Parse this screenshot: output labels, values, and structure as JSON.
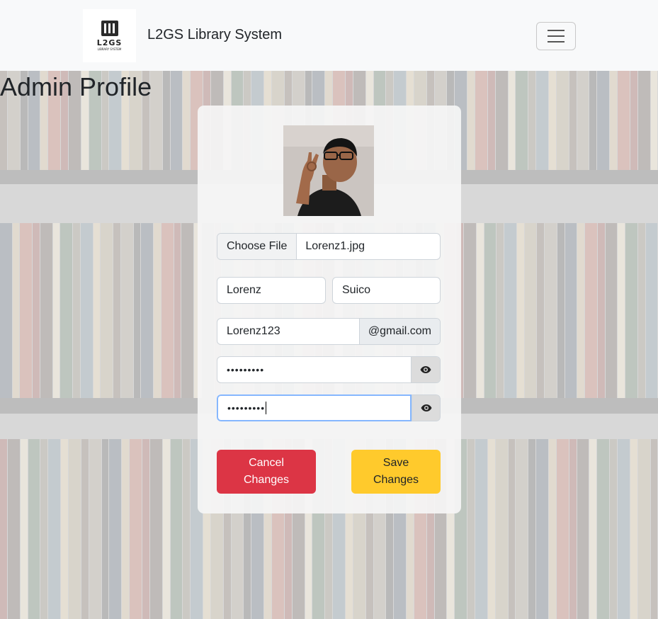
{
  "navbar": {
    "logo_text": "L2GS",
    "logo_subtext": "LIBRARY SYSTEM",
    "brand": "L2GS Library System"
  },
  "page": {
    "title": "Admin Profile"
  },
  "form": {
    "file_button": "Choose File",
    "file_name": "Lorenz1.jpg",
    "first_name": "Lorenz",
    "last_name": "Suico",
    "email_user": "Lorenz123",
    "email_domain": "@gmail.com",
    "password_mask": "•••••••••",
    "confirm_password_mask": "•••••••••"
  },
  "buttons": {
    "cancel": "Cancel Changes",
    "save": "Save Changes"
  },
  "colors": {
    "cancel": "#dc3545",
    "save": "#ffca2c",
    "focus": "#86b7fe"
  }
}
